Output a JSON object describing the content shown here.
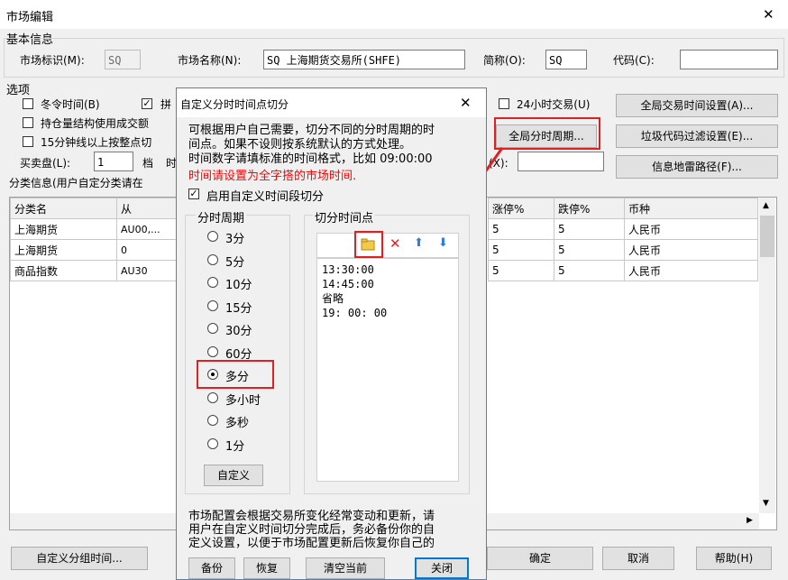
{
  "window": {
    "title": "市场编辑",
    "close": "✕"
  },
  "basic": {
    "group_label": "基本信息",
    "market_id_label": "市场标识(M):",
    "market_id_value": "SQ",
    "market_name_label": "市场名称(N):",
    "market_name_value": "SQ 上海期货交易所(SHFE)",
    "short_label": "简称(O):",
    "short_value": "SQ",
    "code_label": "代码(C):",
    "code_value": ""
  },
  "options": {
    "group_label": "选项",
    "winter_time": "冬令时间(B)",
    "pin": "拼",
    "position_structure": "持仓量结构使用成交额",
    "fifteen_min": "15分钟线以上按整点切",
    "hours24": "24小时交易(U)",
    "buy_sell_label": "买卖盘(L):",
    "buy_sell_value": "1",
    "dang": "档",
    "shi": "时",
    "x_label": "(X):",
    "x_value": ""
  },
  "right_buttons": {
    "global_trade_time": "全局交易时间设置(A)...",
    "global_period": "全局分时周期...",
    "junk_filter": "垃圾代码过滤设置(E)...",
    "info_path": "信息地雷路径(F)..."
  },
  "category": {
    "label": "分类信息(用户自定分类请在",
    "left_headers": [
      "分类名",
      "从"
    ],
    "left_rows": [
      [
        "上海期货",
        "AU00,..."
      ],
      [
        "上海期货",
        "0"
      ],
      [
        "商品指数",
        "AU30"
      ]
    ],
    "right_headers": [
      "涨停%",
      "跌停%",
      "币种"
    ],
    "right_rows": [
      [
        "5",
        "5",
        "人民币"
      ],
      [
        "5",
        "5",
        "人民币"
      ],
      [
        "5",
        "5",
        "人民币"
      ]
    ]
  },
  "bottom": {
    "custom_group_time": "自定义分组时间...",
    "ok": "确定",
    "cancel": "取消",
    "help": "帮助(H)"
  },
  "dialog": {
    "title": "自定义分时时间点切分",
    "close": "✕",
    "desc1": "可根据用户自己需要，切分不同的分时周期的时",
    "desc2": "间点。如果不设则按系统默认的方式处理。",
    "desc3": "时间数字请填标准的时间格式，比如 09:00:00",
    "warning": "时间请设置为全字搭的市场时间.",
    "enable_label": "启用自定义时间段切分",
    "period_group": "分时周期",
    "periods": [
      "3分",
      "5分",
      "10分",
      "15分",
      "30分",
      "60分",
      "多分",
      "多小时",
      "多秒",
      "1分"
    ],
    "selected_period": "多分",
    "custom_button": "自定义",
    "points_group": "切分时间点",
    "points": [
      "13:30:00",
      "14:45:00",
      "省略",
      "19: 00: 00"
    ],
    "note1": "市场配置会根据交易所变化经常变动和更新，请",
    "note2": "用户在自定义时间切分完成后，务必备份你的自",
    "note3": "定义设置，以便于市场配置更新后恢复你自己的",
    "backup": "备份",
    "restore": "恢复",
    "clear": "清空当前",
    "close_button": "关闭"
  },
  "colors": {
    "red_highlight": "#e02020",
    "warning_text": "#ff0000",
    "selection_blue": "#0078d7"
  }
}
